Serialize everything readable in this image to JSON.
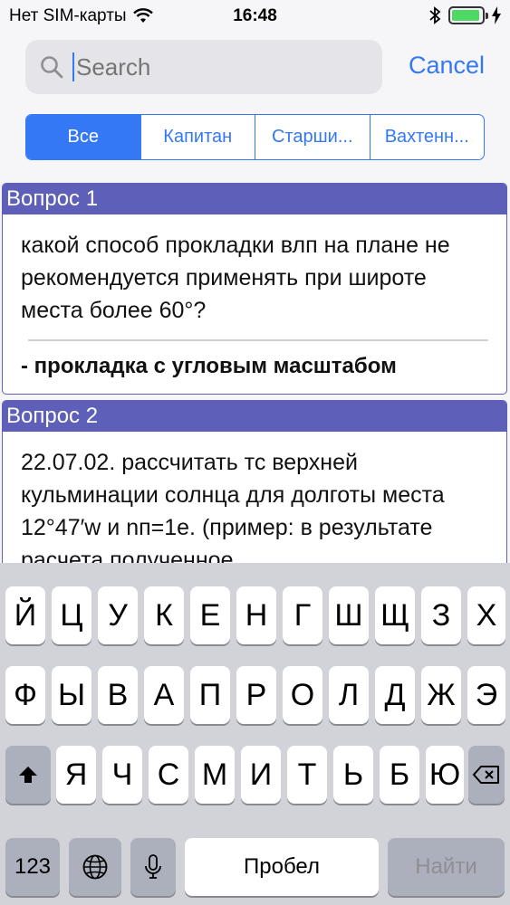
{
  "status_bar": {
    "carrier": "Нет SIM-карты",
    "time": "16:48",
    "battery_level": 0.95
  },
  "search": {
    "placeholder": "Search",
    "cancel_label": "Cancel"
  },
  "segments": [
    {
      "label": "Все",
      "active": true
    },
    {
      "label": "Капитан",
      "active": false
    },
    {
      "label": "Старши...",
      "active": false
    },
    {
      "label": "Вахтенн...",
      "active": false
    }
  ],
  "questions": [
    {
      "title": "Вопрос 1",
      "text": "какой способ прокладки влп на плане не рекомендуется применять при широте места более 60°?",
      "answer": "- прокладка с угловым масштабом"
    },
    {
      "title": "Вопрос 2",
      "text": "22.07.02. рассчитать тс верхней кульминации солнца для долготы места 12°47′w и nп=1е. (пример: в результате расчета полученное",
      "answer": ""
    }
  ],
  "keyboard": {
    "row1": [
      "Й",
      "Ц",
      "У",
      "К",
      "Е",
      "Н",
      "Г",
      "Ш",
      "Щ",
      "З",
      "Х"
    ],
    "row2": [
      "Ф",
      "Ы",
      "В",
      "А",
      "П",
      "Р",
      "О",
      "Л",
      "Д",
      "Ж",
      "Э"
    ],
    "row3": [
      "Я",
      "Ч",
      "С",
      "М",
      "И",
      "Т",
      "Ь",
      "Б",
      "Ю"
    ],
    "numbers_label": "123",
    "space_label": "Пробел",
    "return_label": "Найти"
  },
  "colors": {
    "accent": "#3478f6",
    "card_header": "#5d5fb8",
    "keyboard_bg": "#d1d3d9"
  }
}
